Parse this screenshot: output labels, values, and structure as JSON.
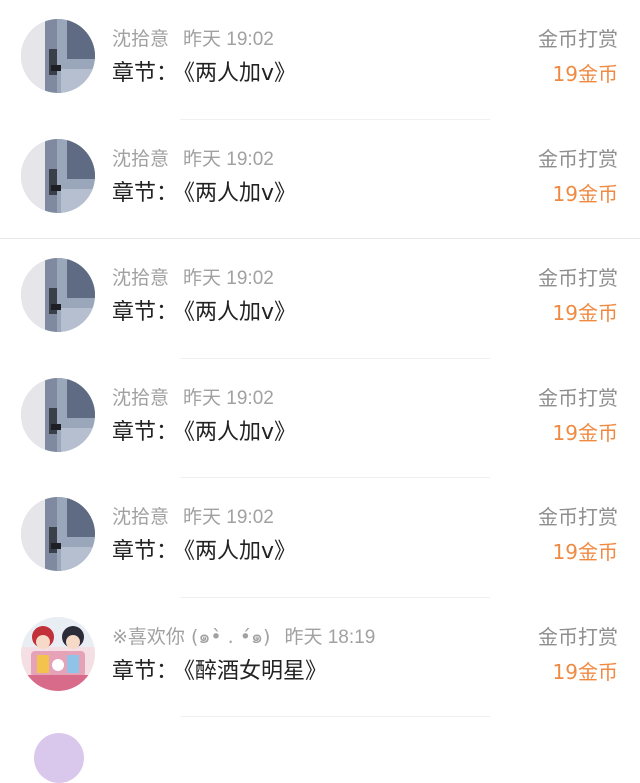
{
  "list": {
    "items": [
      {
        "user_name": "沈拾意",
        "time": "昨天 19:02",
        "chapter_prefix": "章节：",
        "chapter_title": "《两人加v》",
        "reward_label": "金币打赏",
        "reward_amount": "19金币",
        "avatar_icon": "avatar-photo"
      },
      {
        "user_name": "沈拾意",
        "time": "昨天 19:02",
        "chapter_prefix": "章节：",
        "chapter_title": "《两人加v》",
        "reward_label": "金币打赏",
        "reward_amount": "19金币",
        "avatar_icon": "avatar-photo"
      },
      {
        "user_name": "沈拾意",
        "time": "昨天 19:02",
        "chapter_prefix": "章节：",
        "chapter_title": "《两人加v》",
        "reward_label": "金币打赏",
        "reward_amount": "19金币",
        "avatar_icon": "avatar-photo"
      },
      {
        "user_name": "沈拾意",
        "time": "昨天 19:02",
        "chapter_prefix": "章节：",
        "chapter_title": "《两人加v》",
        "reward_label": "金币打赏",
        "reward_amount": "19金币",
        "avatar_icon": "avatar-photo"
      },
      {
        "user_name": "沈拾意",
        "time": "昨天 19:02",
        "chapter_prefix": "章节：",
        "chapter_title": "《两人加v》",
        "reward_label": "金币打赏",
        "reward_amount": "19金币",
        "avatar_icon": "avatar-photo"
      },
      {
        "user_name": "※喜欢你 (๑•̀ . •́๑)",
        "time": "昨天 18:19",
        "chapter_prefix": "章节：",
        "chapter_title": "《醉酒女明星》",
        "reward_label": "金币打赏",
        "reward_amount": "19金币",
        "avatar_icon": "avatar-illustration"
      }
    ]
  },
  "colors": {
    "name_gray": "#a1a1a1",
    "chapter_text": "#222222",
    "reward_label_gray": "#8e8e8e",
    "reward_orange": "#f08a42",
    "divider": "#ececec"
  }
}
